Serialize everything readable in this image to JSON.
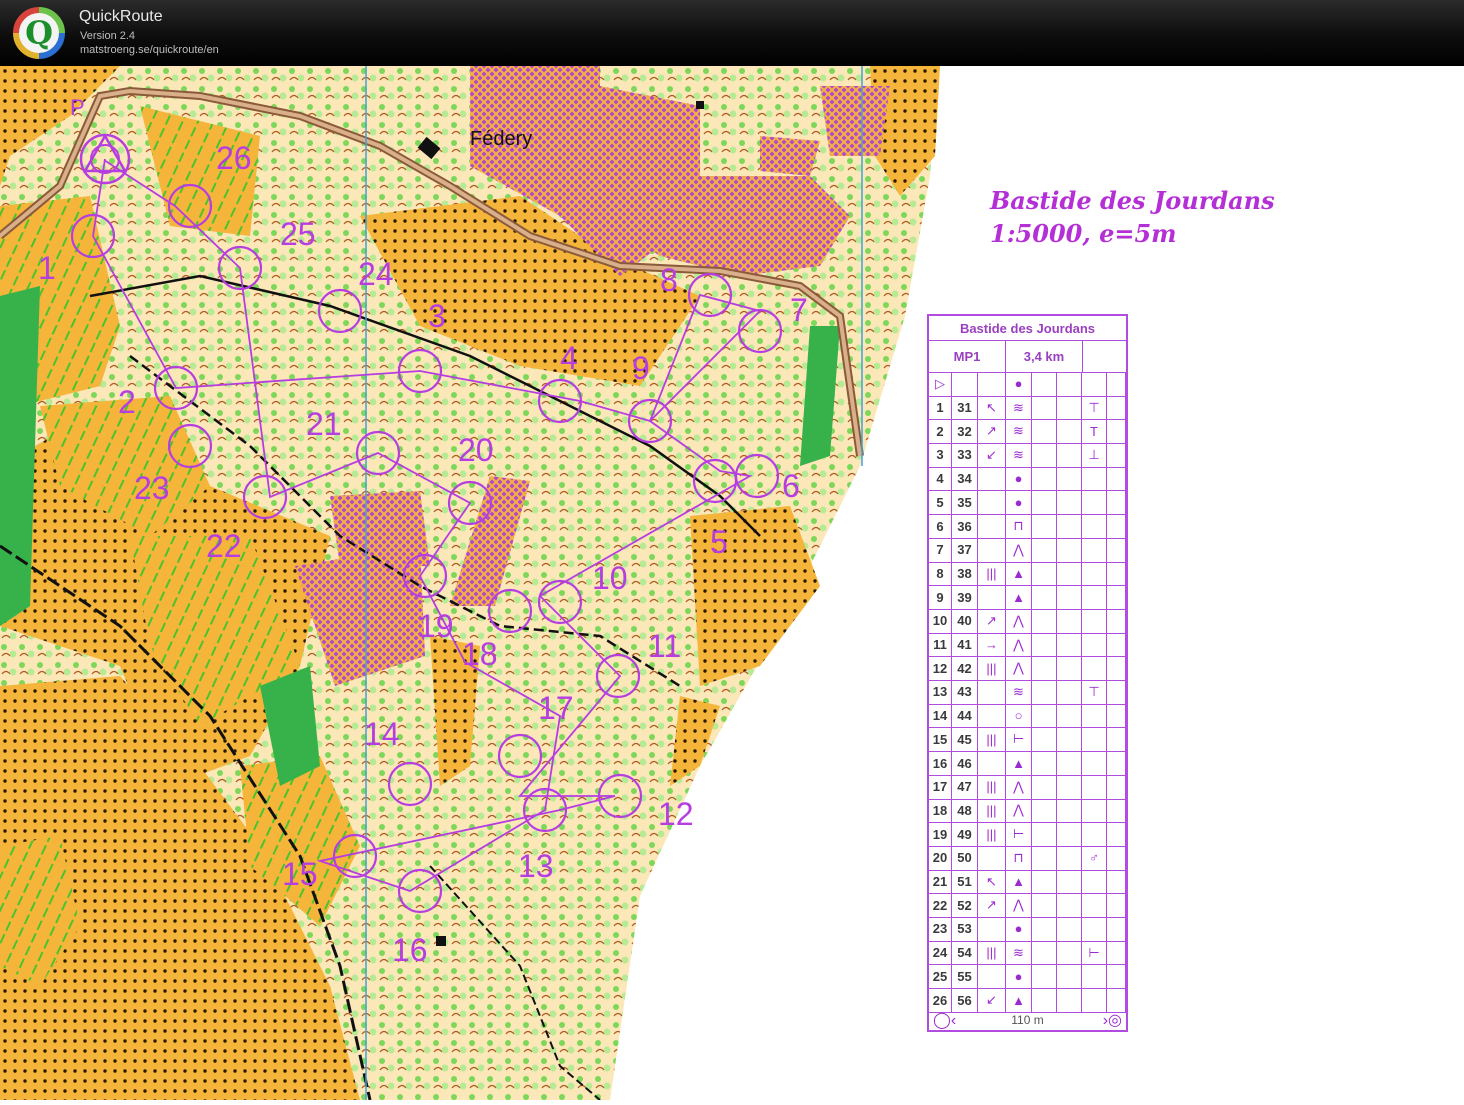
{
  "window": {
    "app_name": "QuickRoute",
    "version": "Version 2.4",
    "url": "matstroeng.se/quickroute/en",
    "logo_letter": "Q"
  },
  "map": {
    "title_line1": "Bastide des Jourdans",
    "title_line2": "1:5000, e=5m",
    "place_name": "Fédery",
    "parking_label": "P",
    "overprint_color": "#b63ee0",
    "controls": [
      "1",
      "2",
      "3",
      "4",
      "5",
      "6",
      "7",
      "8",
      "9",
      "10",
      "11",
      "12",
      "13",
      "14",
      "15",
      "16",
      "17",
      "18",
      "19",
      "20",
      "21",
      "22",
      "23",
      "24",
      "25",
      "26"
    ]
  },
  "description": {
    "event": "Bastide des Jourdans",
    "course": "MP1",
    "length": "3,4 km",
    "start_symbol": "▷",
    "start_feature": "●",
    "rows": [
      {
        "n": "1",
        "code": "31",
        "dir": "↖",
        "feat": "≋",
        "extra": "",
        "pos": "⊤"
      },
      {
        "n": "2",
        "code": "32",
        "dir": "↗",
        "feat": "≋",
        "extra": "",
        "pos": "T"
      },
      {
        "n": "3",
        "code": "33",
        "dir": "↙",
        "feat": "≋",
        "extra": "",
        "pos": "⊥"
      },
      {
        "n": "4",
        "code": "34",
        "dir": "",
        "feat": "●",
        "extra": "",
        "pos": ""
      },
      {
        "n": "5",
        "code": "35",
        "dir": "",
        "feat": "●",
        "extra": "",
        "pos": ""
      },
      {
        "n": "6",
        "code": "36",
        "dir": "",
        "feat": "⊓",
        "extra": "",
        "pos": ""
      },
      {
        "n": "7",
        "code": "37",
        "dir": "",
        "feat": "⋀",
        "extra": "",
        "pos": ""
      },
      {
        "n": "8",
        "code": "38",
        "dir": "|||",
        "feat": "▲",
        "extra": "",
        "pos": ""
      },
      {
        "n": "9",
        "code": "39",
        "dir": "",
        "feat": "▲",
        "extra": "",
        "pos": ""
      },
      {
        "n": "10",
        "code": "40",
        "dir": "↗",
        "feat": "⋀",
        "extra": "",
        "pos": ""
      },
      {
        "n": "11",
        "code": "41",
        "dir": "→",
        "feat": "⋀",
        "extra": "",
        "pos": ""
      },
      {
        "n": "12",
        "code": "42",
        "dir": "|||",
        "feat": "⋀",
        "extra": "",
        "pos": ""
      },
      {
        "n": "13",
        "code": "43",
        "dir": "",
        "feat": "≋",
        "extra": "",
        "pos": "⊤"
      },
      {
        "n": "14",
        "code": "44",
        "dir": "",
        "feat": "○",
        "extra": "",
        "pos": ""
      },
      {
        "n": "15",
        "code": "45",
        "dir": "|||",
        "feat": "⊢",
        "extra": "",
        "pos": ""
      },
      {
        "n": "16",
        "code": "46",
        "dir": "",
        "feat": "▲",
        "extra": "",
        "pos": ""
      },
      {
        "n": "17",
        "code": "47",
        "dir": "|||",
        "feat": "⋀",
        "extra": "",
        "pos": ""
      },
      {
        "n": "18",
        "code": "48",
        "dir": "|||",
        "feat": "⋀",
        "extra": "",
        "pos": ""
      },
      {
        "n": "19",
        "code": "49",
        "dir": "|||",
        "feat": "⊢",
        "extra": "",
        "pos": ""
      },
      {
        "n": "20",
        "code": "50",
        "dir": "",
        "feat": "⊓",
        "extra": "",
        "pos": "♂"
      },
      {
        "n": "21",
        "code": "51",
        "dir": "↖",
        "feat": "▲",
        "extra": "",
        "pos": ""
      },
      {
        "n": "22",
        "code": "52",
        "dir": "↗",
        "feat": "⋀",
        "extra": "",
        "pos": ""
      },
      {
        "n": "23",
        "code": "53",
        "dir": "",
        "feat": "●",
        "extra": "",
        "pos": ""
      },
      {
        "n": "24",
        "code": "54",
        "dir": "|||",
        "feat": "≋",
        "extra": "",
        "pos": "⊢"
      },
      {
        "n": "25",
        "code": "55",
        "dir": "",
        "feat": "●",
        "extra": "",
        "pos": ""
      },
      {
        "n": "26",
        "code": "56",
        "dir": "↙",
        "feat": "▲",
        "extra": "",
        "pos": ""
      }
    ],
    "finish_length": "110 m"
  }
}
